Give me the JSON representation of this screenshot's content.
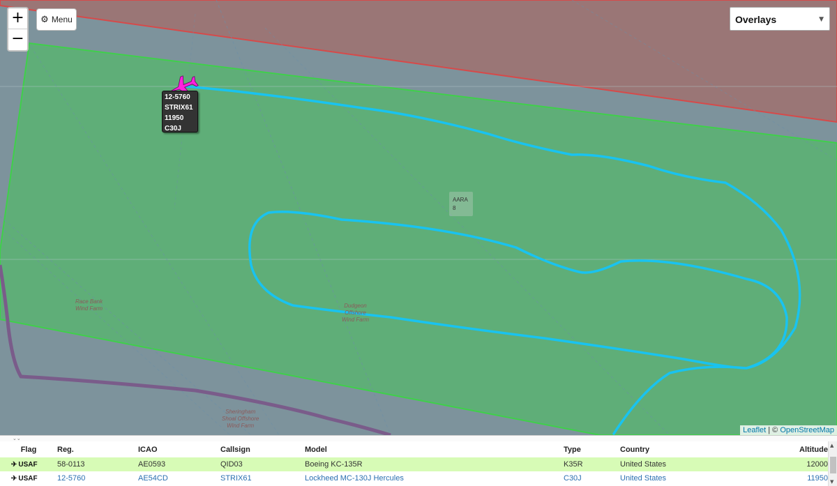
{
  "map": {
    "zoom_in": "+",
    "zoom_out": "−",
    "menu_label": "Menu",
    "overlays_label": "Overlays",
    "aircraft_label": [
      "12-5760",
      "STRIX61",
      "11950",
      "C30J"
    ],
    "aara_label": [
      "AARA",
      "8"
    ],
    "wind_farms": [
      [
        "Race Bank",
        "Wind Farm"
      ],
      [
        "Dudgeon",
        "Offshore",
        "Wind Farm"
      ],
      [
        "Sheringham",
        "Shoal Offshore",
        "Wind Farm"
      ]
    ],
    "attribution_leaflet": "Leaflet",
    "attribution_sep": " | © ",
    "attribution_osm": "OpenStreetMap",
    "colors": {
      "track": "#19c3f0",
      "aircraft": "#ff22dd",
      "zone_green": "#5fb57a",
      "zone_red": "#9c7474"
    }
  },
  "table": {
    "headers": [
      "Flag",
      "Reg.",
      "ICAO",
      "Callsign",
      "Model",
      "Type",
      "Country",
      "Altitude"
    ],
    "rows": [
      {
        "flag": "USAF",
        "reg": "58-0113",
        "icao": "AE0593",
        "callsign": "QID03",
        "model": "Boeing KC-135R",
        "type": "K35R",
        "country": "United States",
        "altitude": "12000"
      },
      {
        "flag": "USAF",
        "reg": "12-5760",
        "icao": "AE54CD",
        "callsign": "STRIX61",
        "model": "Lockheed MC-130J Hercules",
        "type": "C30J",
        "country": "United States",
        "altitude": "11950"
      }
    ]
  }
}
